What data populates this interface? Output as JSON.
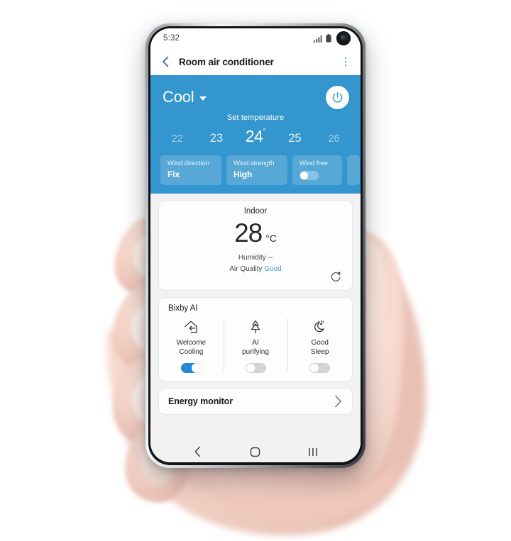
{
  "device": {
    "type": "smartphone",
    "model_style": "punch-hole-camera-phone"
  },
  "status_bar": {
    "time": "5:32",
    "icons": [
      "signal-bars-icon",
      "battery-icon",
      "front-camera"
    ]
  },
  "app_bar": {
    "back_icon": "chevron-left-icon",
    "title": "Room air conditioner",
    "menu_icon": "kebab-menu-icon"
  },
  "ac_panel": {
    "accent_color": "#3396ce",
    "mode": "Cool",
    "mode_caret": "chevron-down-icon",
    "power_icon": "power-icon",
    "set_temperature_label": "Set temperature",
    "temperature_scale": [
      {
        "value": "22",
        "state": "far"
      },
      {
        "value": "23",
        "state": "near"
      },
      {
        "value": "24",
        "state": "selected",
        "degree": "°"
      },
      {
        "value": "25",
        "state": "near"
      },
      {
        "value": "26",
        "state": "far"
      }
    ],
    "controls": [
      {
        "title": "Wind direction",
        "value": "Fix",
        "type": "value"
      },
      {
        "title": "Wind strength",
        "value": "High",
        "type": "value"
      },
      {
        "title": "Wind free",
        "value": "",
        "type": "toggle",
        "on": false
      }
    ]
  },
  "indoor_card": {
    "title": "Indoor",
    "temperature": "28",
    "unit": "°C",
    "humidity_line": "Humidity --",
    "air_quality_label": "Air Quality",
    "air_quality_value": "Good",
    "air_quality_color": "#3c9cd8",
    "refresh_icon": "refresh-icon"
  },
  "bixby_card": {
    "title": "Bixby AI",
    "items": [
      {
        "icon": "home-arrow-icon",
        "line1": "Welcome",
        "line2": "Cooling",
        "toggle_on": true
      },
      {
        "icon": "pine-tree-icon",
        "line1": "AI",
        "line2": "purifying",
        "toggle_on": false
      },
      {
        "icon": "moon-sleep-icon",
        "line1": "Good",
        "line2": "Sleep",
        "toggle_on": false
      }
    ]
  },
  "energy_card": {
    "label": "Energy monitor",
    "chevron_icon": "chevron-right-icon"
  },
  "nav_bar": {
    "back_icon": "nav-back-icon",
    "home_icon": "nav-home-icon",
    "recents_icon": "nav-recents-icon"
  }
}
